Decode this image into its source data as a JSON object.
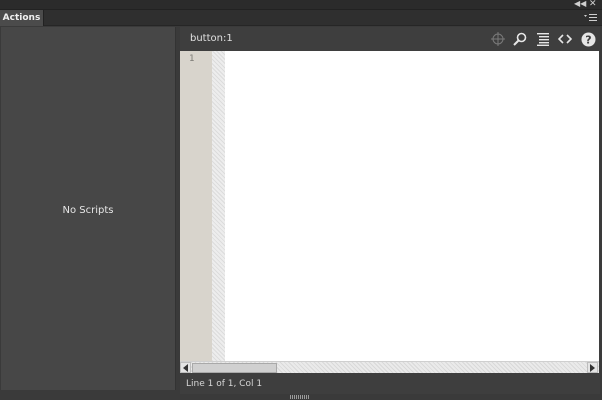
{
  "panel": {
    "tab_label": "Actions"
  },
  "window_controls": {
    "collapse_icon": "collapse-icon",
    "close_icon": "close-icon"
  },
  "left_pane": {
    "empty_message": "No Scripts"
  },
  "script_pane": {
    "title": "button:1",
    "toolbar_icons": [
      "insert-target-icon",
      "find-icon",
      "code-format-icon",
      "code-snippets-icon",
      "help-icon"
    ],
    "line_numbers": [
      "1"
    ]
  },
  "status_bar": {
    "text": "Line 1 of 1, Col 1"
  },
  "colors": {
    "panel_bg": "#3a3a3a",
    "editor_bg": "#ffffff",
    "gutter_bg": "#d8d4cc"
  }
}
